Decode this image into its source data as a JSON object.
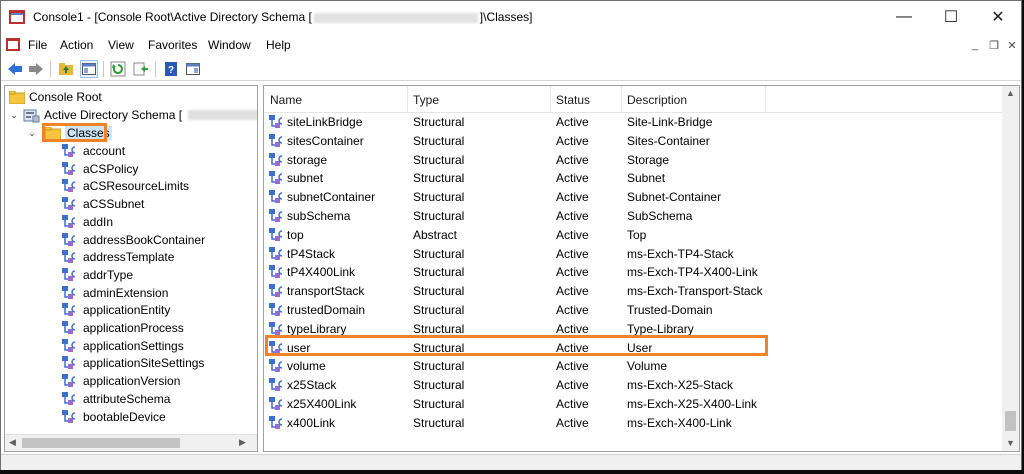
{
  "window": {
    "title_prefix": "Console1 - [Console Root\\Active Directory Schema [",
    "title_suffix": "]\\Classes]",
    "minimize": "—",
    "maximize": "☐",
    "close": "✕"
  },
  "menu": {
    "items": [
      "File",
      "Action",
      "View",
      "Favorites",
      "Window",
      "Help"
    ],
    "mdi_minimize": "_",
    "mdi_restore": "❐",
    "mdi_close": "✕"
  },
  "tree": {
    "root": "Console Root",
    "schema": "Active Directory Schema [",
    "classes": "Classes",
    "children": [
      "account",
      "aCSPolicy",
      "aCSResourceLimits",
      "aCSSubnet",
      "addIn",
      "addressBookContainer",
      "addressTemplate",
      "addrType",
      "adminExtension",
      "applicationEntity",
      "applicationProcess",
      "applicationSettings",
      "applicationSiteSettings",
      "applicationVersion",
      "attributeSchema",
      "bootableDevice"
    ]
  },
  "list": {
    "columns": [
      "Name",
      "Type",
      "Status",
      "Description"
    ],
    "rows": [
      {
        "name": "siteLinkBridge",
        "type": "Structural",
        "status": "Active",
        "description": "Site-Link-Bridge"
      },
      {
        "name": "sitesContainer",
        "type": "Structural",
        "status": "Active",
        "description": "Sites-Container"
      },
      {
        "name": "storage",
        "type": "Structural",
        "status": "Active",
        "description": "Storage"
      },
      {
        "name": "subnet",
        "type": "Structural",
        "status": "Active",
        "description": "Subnet"
      },
      {
        "name": "subnetContainer",
        "type": "Structural",
        "status": "Active",
        "description": "Subnet-Container"
      },
      {
        "name": "subSchema",
        "type": "Structural",
        "status": "Active",
        "description": "SubSchema"
      },
      {
        "name": "top",
        "type": "Abstract",
        "status": "Active",
        "description": "Top"
      },
      {
        "name": "tP4Stack",
        "type": "Structural",
        "status": "Active",
        "description": "ms-Exch-TP4-Stack"
      },
      {
        "name": "tP4X400Link",
        "type": "Structural",
        "status": "Active",
        "description": "ms-Exch-TP4-X400-Link"
      },
      {
        "name": "transportStack",
        "type": "Structural",
        "status": "Active",
        "description": "ms-Exch-Transport-Stack"
      },
      {
        "name": "trustedDomain",
        "type": "Structural",
        "status": "Active",
        "description": "Trusted-Domain"
      },
      {
        "name": "typeLibrary",
        "type": "Structural",
        "status": "Active",
        "description": "Type-Library"
      },
      {
        "name": "user",
        "type": "Structural",
        "status": "Active",
        "description": "User"
      },
      {
        "name": "volume",
        "type": "Structural",
        "status": "Active",
        "description": "Volume"
      },
      {
        "name": "x25Stack",
        "type": "Structural",
        "status": "Active",
        "description": "ms-Exch-X25-Stack"
      },
      {
        "name": "x25X400Link",
        "type": "Structural",
        "status": "Active",
        "description": "ms-Exch-X25-X400-Link"
      },
      {
        "name": "x400Link",
        "type": "Structural",
        "status": "Active",
        "description": "ms-Exch-X400-Link"
      }
    ]
  },
  "colors": {
    "highlight": "#f0832a",
    "icon_blue": "#3c6fd0",
    "icon_purple": "#9b6bd0",
    "folder": "#f5c542"
  }
}
